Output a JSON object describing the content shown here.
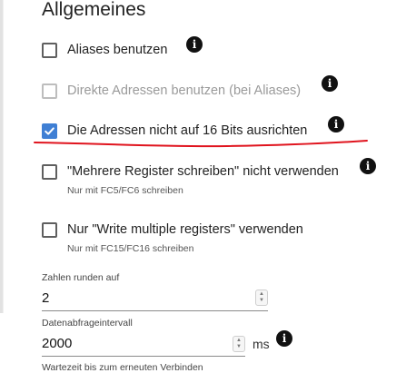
{
  "section": {
    "title": "Allgemeines"
  },
  "options": [
    {
      "label": "Aliases benutzen",
      "checked": false,
      "disabled": false
    },
    {
      "label": "Direkte Adressen benutzen (bei Aliases)",
      "checked": false,
      "disabled": true
    },
    {
      "label": "Die Adressen nicht auf 16 Bits ausrichten",
      "checked": true,
      "disabled": false
    },
    {
      "label": "\"Mehrere Register schreiben\" nicht verwenden",
      "helper": "Nur mit FC5/FC6 schreiben",
      "checked": false,
      "disabled": false
    },
    {
      "label": "Nur \"Write multiple registers\" verwenden",
      "helper": "Nur mit FC15/FC16 schreiben",
      "checked": false,
      "disabled": false
    }
  ],
  "fields": {
    "round": {
      "label": "Zahlen runden auf",
      "value": "2"
    },
    "poll": {
      "label": "Datenabfrageintervall",
      "value": "2000",
      "unit": "ms"
    },
    "reconnect": {
      "label": "Wartezeit bis zum erneuten Verbinden"
    }
  },
  "colors": {
    "accent": "#3f7fd4",
    "annotation": "#e0141e"
  },
  "icons": {
    "info": "info-icon",
    "check": "check-icon"
  }
}
